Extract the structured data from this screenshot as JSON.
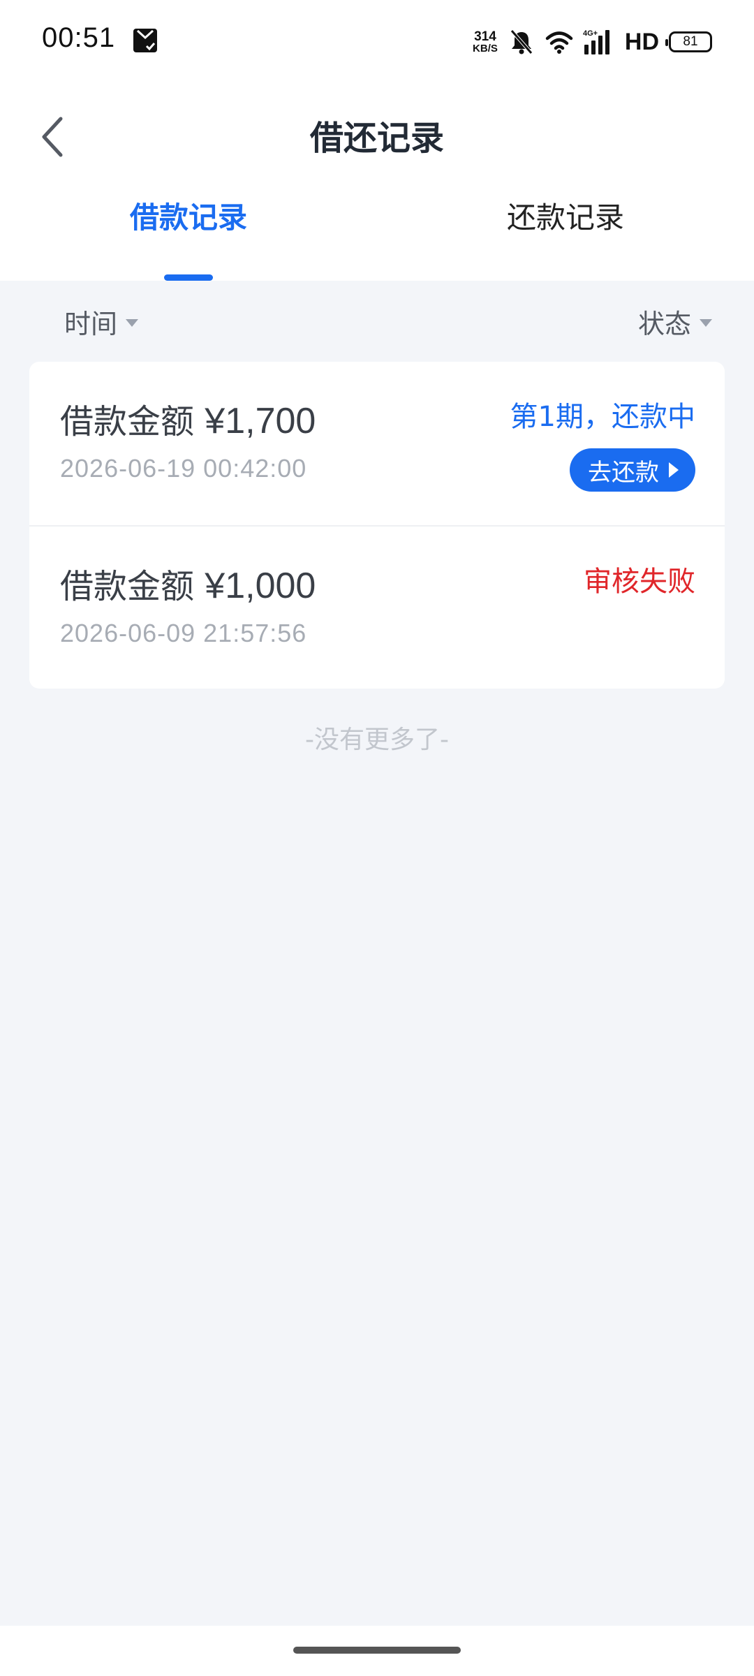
{
  "status_bar": {
    "time": "00:51",
    "net_speed_value": "314",
    "net_speed_unit": "KB/S",
    "network_label": "4G+",
    "hd_label": "HD",
    "battery_level": "81"
  },
  "header": {
    "title": "借还记录",
    "back_icon": "chevron-left-icon"
  },
  "tabs": [
    {
      "label": "借款记录",
      "active": true
    },
    {
      "label": "还款记录",
      "active": false
    }
  ],
  "filters": {
    "time_label": "时间",
    "status_label": "状态"
  },
  "records": [
    {
      "amount_label": "借款金额",
      "amount": "¥1,700",
      "date": "2026-06-19 00:42:00",
      "status": "第1期，还款中",
      "status_color": "#1a6cf0",
      "action_label": "去还款"
    },
    {
      "amount_label": "借款金额",
      "amount": "¥1,000",
      "date": "2026-06-09 21:57:56",
      "status": "审核失败",
      "status_color": "#e0262a"
    }
  ],
  "footer_note": "-没有更多了-",
  "colors": {
    "accent": "#1a6cf0",
    "error": "#e0262a",
    "background": "#f3f5f9"
  }
}
